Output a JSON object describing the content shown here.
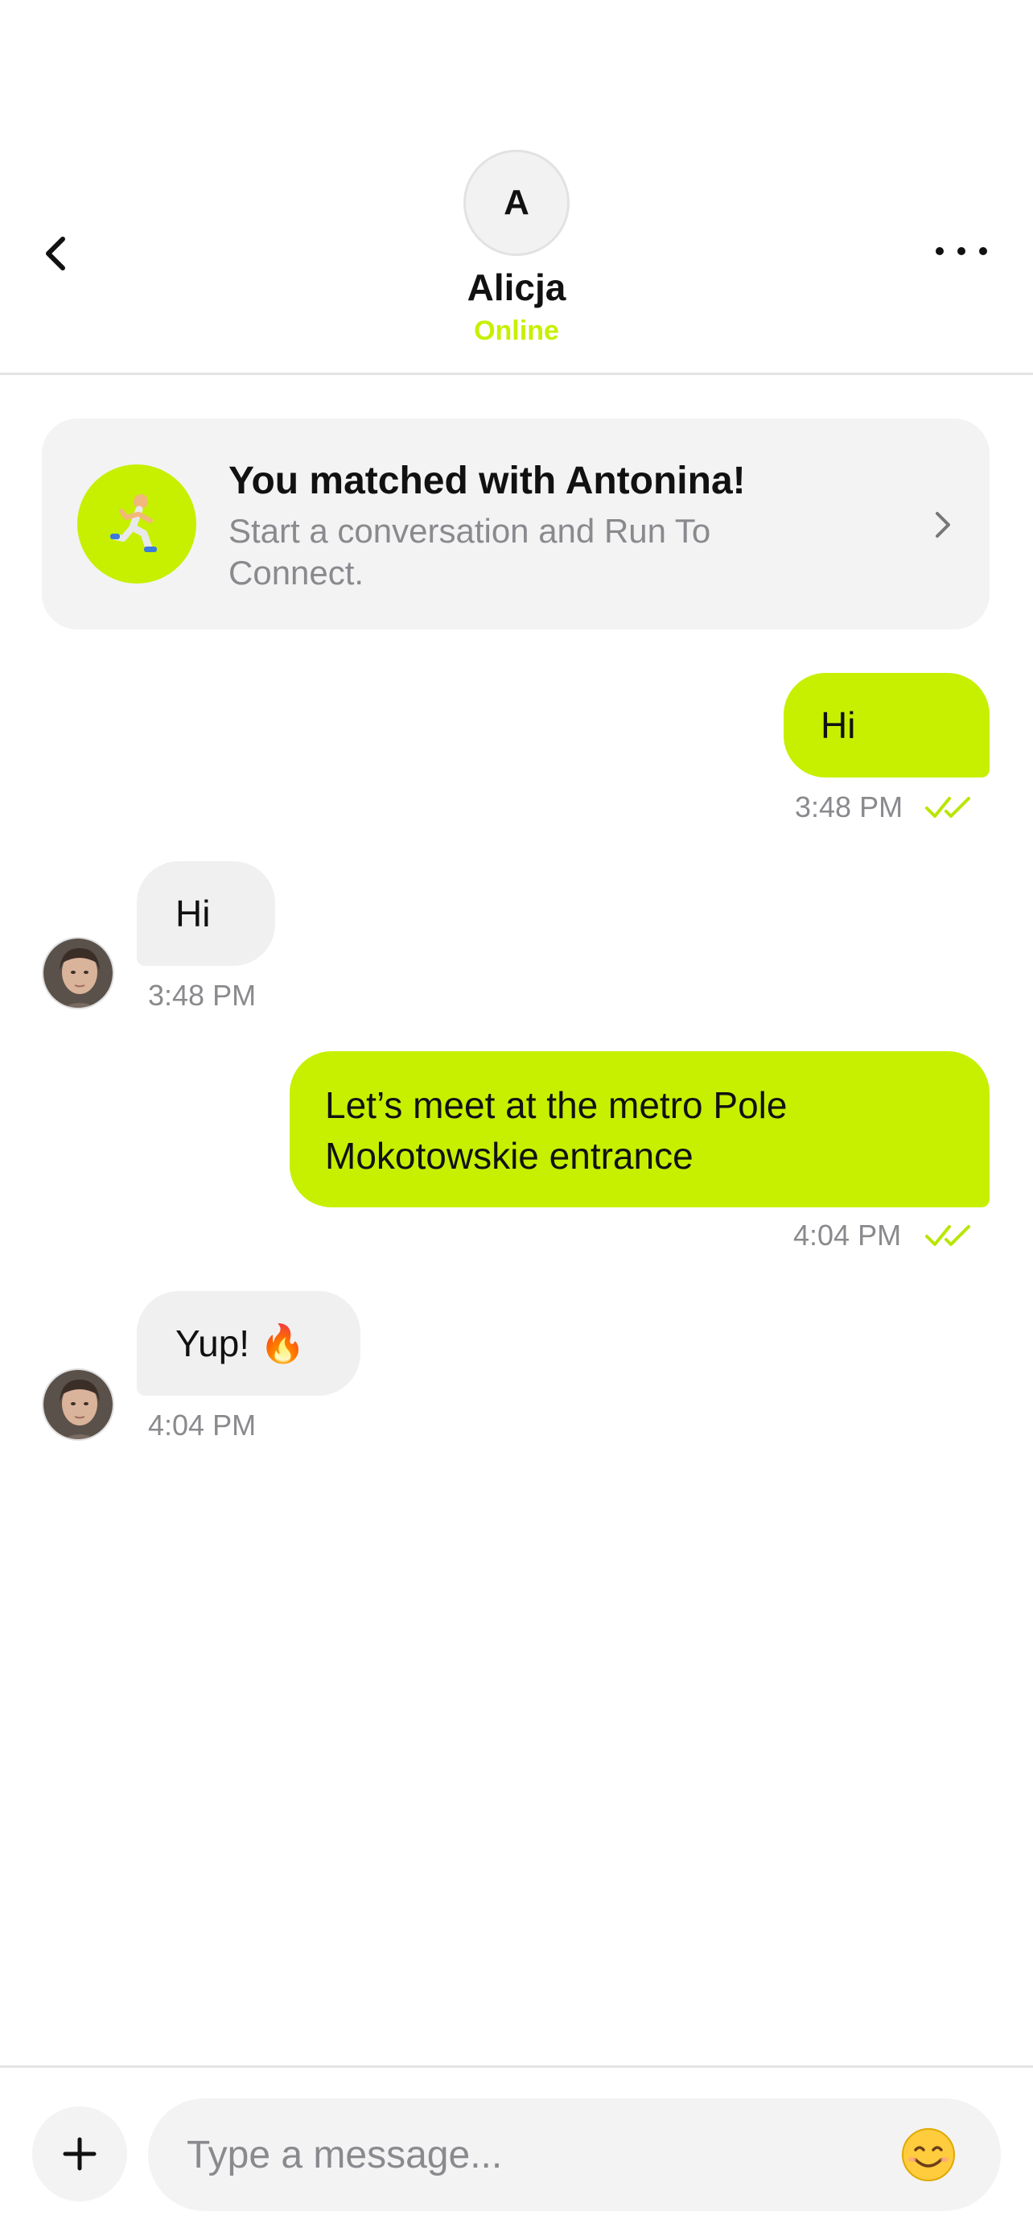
{
  "header": {
    "back_icon": "chevron-left-icon",
    "more_icon": "more-horizontal-icon",
    "avatar_initial": "A",
    "contact_name": "Alicja",
    "status": "Online"
  },
  "match_card": {
    "icon": "runner-emoji-icon",
    "title": "You matched with Antonina!",
    "subtitle": "Start a conversation and Run To Connect.",
    "chevron_icon": "chevron-right-icon"
  },
  "messages": [
    {
      "direction": "outgoing",
      "text": "Hi",
      "time": "3:48 PM",
      "status_icon": "double-check-icon"
    },
    {
      "direction": "incoming",
      "text": "Hi",
      "time": "3:48 PM"
    },
    {
      "direction": "outgoing",
      "text": "Let’s meet at the metro Pole Mokotowskie entrance",
      "time": "4:04 PM",
      "status_icon": "double-check-icon"
    },
    {
      "direction": "incoming",
      "text": "Yup! 🔥",
      "time": "4:04 PM"
    }
  ],
  "input_bar": {
    "attach_icon": "plus-icon",
    "placeholder": "Type a message...",
    "emoji_icon": "smiley-emoji-icon"
  },
  "colors": {
    "accent": "#c6f000",
    "bubble_incoming": "#f0f0f1",
    "card_background": "#f3f3f4",
    "muted_text": "#8a8a8e",
    "tick": "#b8e600"
  }
}
